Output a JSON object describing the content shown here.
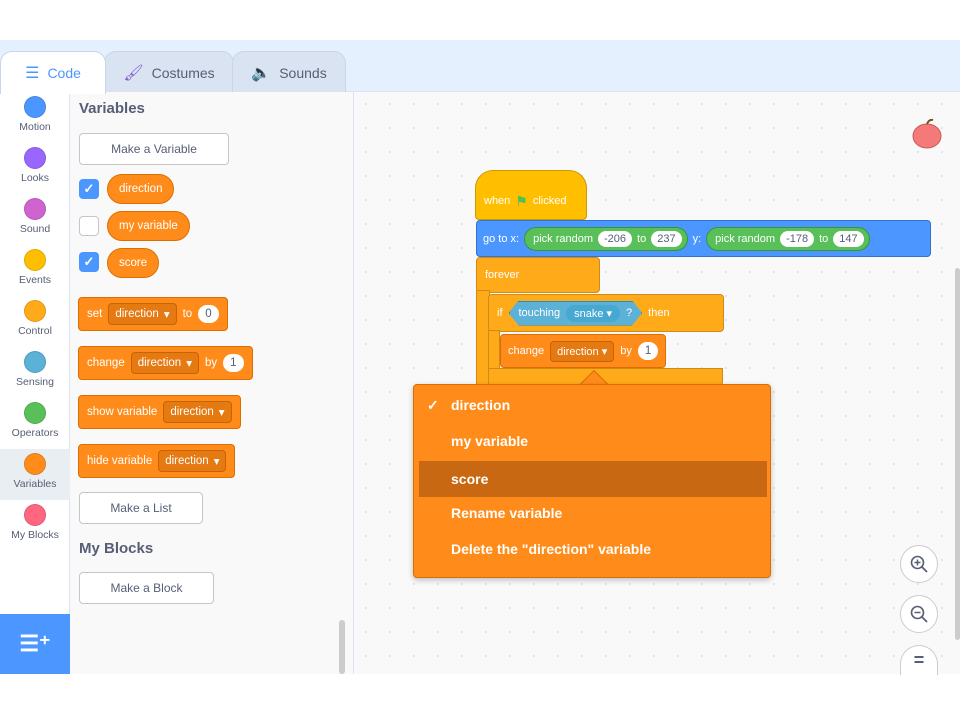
{
  "tabs": [
    {
      "label": "Code",
      "icon": "code-icon"
    },
    {
      "label": "Costumes",
      "icon": "brush-icon"
    },
    {
      "label": "Sounds",
      "icon": "speaker-icon"
    }
  ],
  "categories": [
    {
      "label": "Motion",
      "color": "#4c97ff"
    },
    {
      "label": "Looks",
      "color": "#9966ff"
    },
    {
      "label": "Sound",
      "color": "#cf63cf"
    },
    {
      "label": "Events",
      "color": "#ffbf00"
    },
    {
      "label": "Control",
      "color": "#ffab19"
    },
    {
      "label": "Sensing",
      "color": "#5cb1d6"
    },
    {
      "label": "Operators",
      "color": "#59c059"
    },
    {
      "label": "Variables",
      "color": "#ff8c1a"
    },
    {
      "label": "My Blocks",
      "color": "#ff6680"
    }
  ],
  "flyout": {
    "variables_title": "Variables",
    "make_variable": "Make a Variable",
    "variables": [
      {
        "name": "direction",
        "checked": true
      },
      {
        "name": "my variable",
        "checked": false
      },
      {
        "name": "score",
        "checked": true
      }
    ],
    "set_block": {
      "label": "set",
      "var": "direction",
      "to": "to",
      "value": "0"
    },
    "change_block": {
      "label": "change",
      "var": "direction",
      "by": "by",
      "value": "1"
    },
    "show_block": {
      "label": "show variable",
      "var": "direction"
    },
    "hide_block": {
      "label": "hide variable",
      "var": "direction"
    },
    "make_list": "Make a List",
    "myblocks_title": "My Blocks",
    "make_block": "Make a Block"
  },
  "script": {
    "hat": {
      "when": "when",
      "clicked": "clicked"
    },
    "goto": {
      "label": "go to x:",
      "x_op": "pick random",
      "x_from": "-206",
      "x_to_label": "to",
      "x_to": "237",
      "y_label": "y:",
      "y_op": "pick random",
      "y_from": "-178",
      "y_to_label": "to",
      "y_to": "147"
    },
    "forever": "forever",
    "if_block": {
      "if": "if",
      "touching": "touching",
      "target": "snake",
      "q": "?",
      "then": "then"
    },
    "change": {
      "label": "change",
      "var": "direction",
      "by": "by",
      "value": "1"
    }
  },
  "dropdown": {
    "items": [
      {
        "label": "direction",
        "checked": true
      },
      {
        "label": "my variable",
        "checked": false
      },
      {
        "label": "score",
        "checked": false,
        "highlighted": true
      },
      {
        "label": "Rename variable",
        "checked": false
      },
      {
        "label": "Delete the \"direction\" variable",
        "checked": false
      }
    ]
  },
  "zoom": {
    "in": "+",
    "out": "−",
    "reset": "="
  }
}
